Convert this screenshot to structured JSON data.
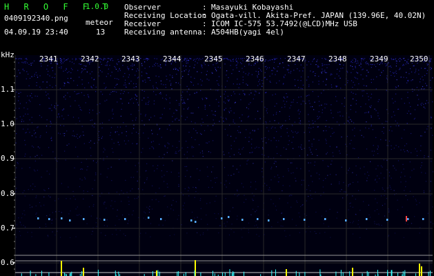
{
  "header": {
    "app_title": "H R O F F T",
    "app_version": "1.0.0",
    "filename": "0409192340.png",
    "timestamp": "04.09.19 23:40",
    "meteor_label": "meteor",
    "meteor_count": "13"
  },
  "info": {
    "rows": [
      {
        "label": "Observer",
        "value": "Masayuki Kobayashi"
      },
      {
        "label": "Receiving Location",
        "value": "Ogata-vill. Akita-Pref. JAPAN (139.96E, 40.02N)"
      },
      {
        "label": "Receiver",
        "value": "ICOM IC-575 53.7492(@LCD)MHz USB"
      },
      {
        "label": "Receiving antenna",
        "value": "A504HB(yagi 4el)"
      }
    ]
  },
  "chart_data": {
    "type": "heatmap",
    "ylabel": "kHz",
    "y_ticks": [
      "1.1",
      "1.0",
      "0.9",
      "0.8",
      "0.7",
      "0.6"
    ],
    "x_ticks": [
      "2341",
      "2342",
      "2343",
      "2344",
      "2345",
      "2346",
      "2347",
      "2348",
      "2349",
      "2350"
    ],
    "grid": true,
    "colors": {
      "background": "#000010",
      "noise": "#1a1a8c",
      "grid": "#2a2a2a",
      "signal": "#55aaff",
      "meteor_bar": "#ffff00",
      "cyan_bar": "#33ffff"
    }
  }
}
